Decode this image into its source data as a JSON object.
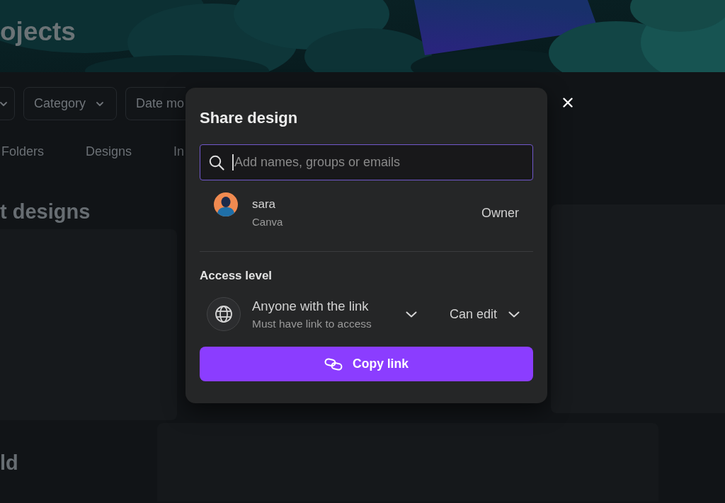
{
  "background_page": {
    "title": "ojects",
    "filters": [
      {
        "chevron": true
      },
      {
        "label": "Category",
        "chevron": true
      },
      {
        "label": "Date mo",
        "chevron": false
      }
    ],
    "tabs": [
      {
        "label": "Folders",
        "selected": false
      },
      {
        "label": "Designs",
        "selected": false
      },
      {
        "label": "In",
        "selected": false
      }
    ],
    "sections": [
      {
        "heading": "t designs"
      },
      {
        "heading": "ld"
      }
    ]
  },
  "dialog": {
    "title": "Share design",
    "search": {
      "placeholder": "Add names, groups or emails",
      "focused": true
    },
    "people": [
      {
        "name": "sara",
        "team": "Canva",
        "role": "Owner"
      }
    ],
    "access": {
      "heading": "Access level",
      "audience": "Anyone with the link",
      "audience_hint": "Must have link to access",
      "permission": "Can edit"
    },
    "primary_button": "Copy link"
  }
}
